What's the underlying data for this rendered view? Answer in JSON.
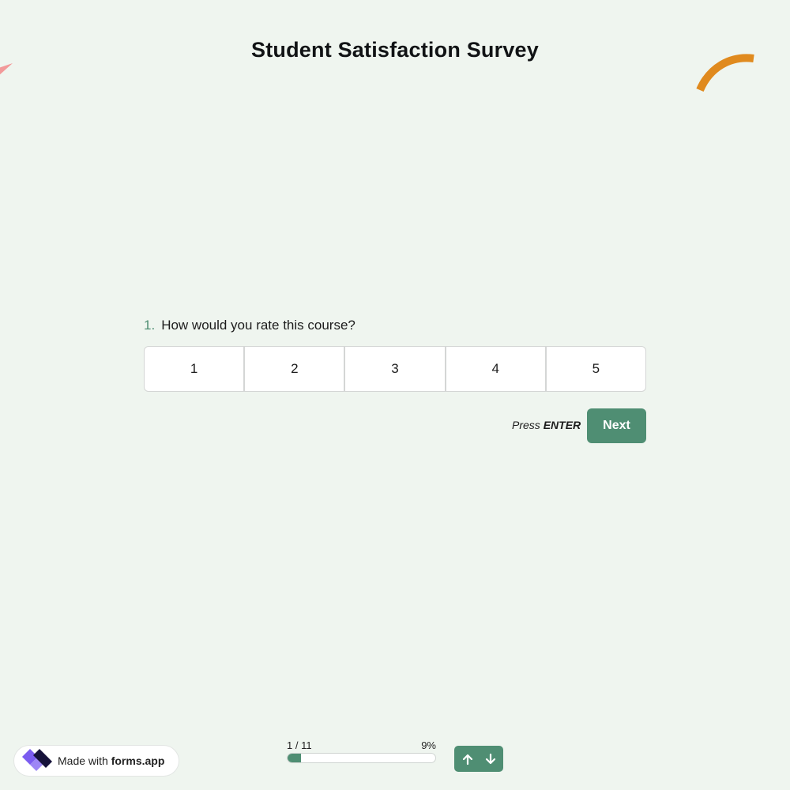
{
  "survey": {
    "title": "Student Satisfaction Survey"
  },
  "question": {
    "number": "1.",
    "text": "How would you rate this course?",
    "options": [
      "1",
      "2",
      "3",
      "4",
      "5"
    ]
  },
  "actions": {
    "press_prefix": "Press ",
    "press_key": "ENTER",
    "next_label": "Next"
  },
  "progress": {
    "count": "1 / 11",
    "percent_label": "9%",
    "fraction": 0.09
  },
  "branding": {
    "prefix": "Made with ",
    "brand": "forms.app"
  },
  "navigation": {
    "up_icon": "arrow-up-icon",
    "down_icon": "arrow-down-icon"
  },
  "colors": {
    "background": "#eff5ef",
    "accent": "#4f8e73",
    "decor_pink": "#f29a9a",
    "decor_orange": "#e08a1e",
    "logo_purple": "#7b5cf0",
    "logo_dark": "#16123a"
  }
}
